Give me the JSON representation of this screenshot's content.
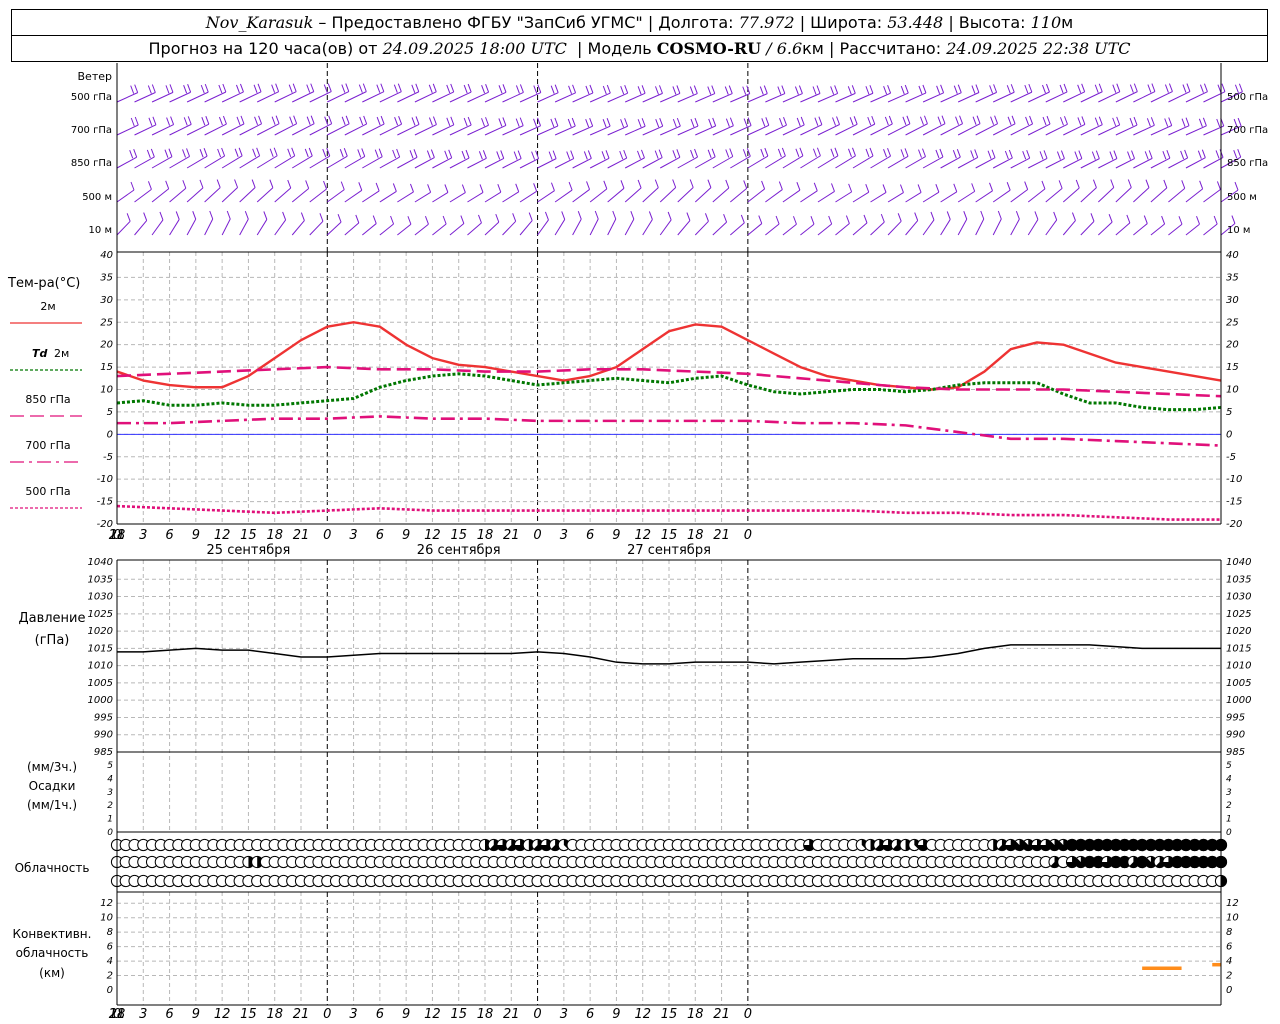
{
  "header": {
    "station": "Nov_Karasuk",
    "provider": "– Предоставлено ФГБУ \"ЗапСиб УГМС\" | Долгота:",
    "lon": "77.972",
    "lat_label": "| Широта:",
    "lat": "53.448",
    "alt_label": "| Высота:",
    "alt": "110",
    "alt_unit": "м",
    "fc_label": "Прогноз на 120 часа(ов) от",
    "fc_start": "24.09.2025 18:00 UTC",
    "model_label": "| Модель",
    "model": "COSMO-RU",
    "res": "/ 6.6",
    "res_unit": "км",
    "calc_label": "| Рассчитано:",
    "calc": "24.09.2025 22:38 UTC"
  },
  "x_ticks": [
    "18",
    "21",
    "0",
    "3",
    "6",
    "9",
    "12",
    "15",
    "18",
    "21",
    "0",
    "3",
    "6",
    "9",
    "12",
    "15",
    "18",
    "21",
    "0",
    "3",
    "6",
    "9",
    "12",
    "15",
    "18",
    "21",
    "0"
  ],
  "date_labels": [
    {
      "text": "25 сентября",
      "hour": 15
    },
    {
      "text": "26 сентября",
      "hour": 39
    },
    {
      "text": "27 сентября",
      "hour": 63
    }
  ],
  "wind_panel": {
    "title": "Ветер",
    "levels": [
      "500 гПа",
      "700 гПа",
      "850 гПа",
      "500 м",
      "10  м"
    ]
  },
  "temp_panel": {
    "title": "Тем-ра(°C)",
    "y_ticks": [
      "40",
      "35",
      "30",
      "25",
      "20",
      "15",
      "10",
      "5",
      "0",
      "-5",
      "-10",
      "-15",
      "-20"
    ],
    "legend": [
      {
        "label": "2м",
        "td": "",
        "color": "#ee3333",
        "dash": ""
      },
      {
        "label": "2м",
        "td": "Td",
        "color": "#007700",
        "dash": "3,2"
      },
      {
        "label": "850 гПа",
        "td": "",
        "color": "#e0107a",
        "dash": "14,6"
      },
      {
        "label": "700 гПа",
        "td": "",
        "color": "#e0107a",
        "dash": "14,5,3,5"
      },
      {
        "label": "500 гПа",
        "td": "",
        "color": "#e0107a",
        "dash": "3,2"
      }
    ]
  },
  "pressure_panel": {
    "title": "Давление",
    "unit": "(гПа)",
    "y_ticks": [
      "1040",
      "1035",
      "1030",
      "1025",
      "1020",
      "1015",
      "1010",
      "1005",
      "1000",
      "995",
      "990",
      "985"
    ]
  },
  "precip_panel": {
    "label_top": "(мм/3ч.)",
    "title": "Осадки",
    "label_bottom": "(мм/1ч.)",
    "y_ticks": [
      "5",
      "4",
      "3",
      "2",
      "1",
      "0"
    ]
  },
  "cloud_panel": {
    "title": "Облачность"
  },
  "conv_panel": {
    "title1": "Конвективн.",
    "title2": "облачность",
    "unit": "(км)",
    "y_ticks": [
      "12",
      "10",
      "8",
      "6",
      "4",
      "2",
      "0"
    ]
  },
  "colors": {
    "wind": "#7a1fd0",
    "t2m": "#ee3333",
    "td2m": "#007700",
    "upper": "#e0107a",
    "zero_line": "#3333ff",
    "pressure": "#000000",
    "conv_cloud": "#ff8c1a"
  },
  "chart_data": [
    {
      "type": "line",
      "title": "Тем-ра(°C)",
      "x_unit": "hours from 24.09.2025 18:00 UTC",
      "ylim": [
        -20,
        40
      ],
      "grid": true,
      "series": [
        {
          "name": "2м",
          "x": [
            0,
            3,
            6,
            9,
            12,
            15,
            18,
            21,
            24,
            27,
            30,
            33,
            36,
            39,
            42,
            45,
            48,
            51,
            54,
            57,
            60,
            63,
            66,
            69,
            72,
            75,
            78,
            81,
            84,
            87,
            90,
            93,
            96,
            99,
            102,
            105,
            108,
            111,
            114,
            117,
            120,
            123,
            126
          ],
          "values": [
            14,
            12,
            11,
            10.5,
            10.5,
            13,
            17,
            21,
            24,
            25,
            24,
            20,
            17,
            15.5,
            15,
            14,
            13,
            12,
            13,
            15,
            19,
            23,
            24.5,
            24,
            21,
            18,
            15,
            13,
            12,
            11,
            10.5,
            10,
            10.5,
            14,
            19,
            20.5,
            20,
            18,
            16,
            15,
            14,
            13,
            12
          ]
        },
        {
          "name": "Td 2м",
          "x": [
            0,
            3,
            6,
            9,
            12,
            15,
            18,
            21,
            24,
            27,
            30,
            33,
            36,
            39,
            42,
            45,
            48,
            51,
            54,
            57,
            60,
            63,
            66,
            69,
            72,
            75,
            78,
            81,
            84,
            87,
            90,
            93,
            96,
            99,
            102,
            105,
            108,
            111,
            114,
            117,
            120,
            123,
            126
          ],
          "values": [
            7,
            7.5,
            6.5,
            6.5,
            7,
            6.5,
            6.5,
            7,
            7.5,
            8,
            10.5,
            12,
            13,
            13.5,
            13,
            12,
            11,
            11.5,
            12,
            12.5,
            12,
            11.5,
            12.5,
            13,
            11,
            9.5,
            9,
            9.5,
            10,
            10,
            9.5,
            10,
            11,
            11.5,
            11.5,
            11.5,
            9,
            7,
            7,
            6,
            5.5,
            5.5,
            6
          ]
        },
        {
          "name": "850 гПа",
          "x": [
            0,
            6,
            12,
            18,
            24,
            30,
            36,
            42,
            48,
            54,
            60,
            66,
            72,
            78,
            84,
            90,
            96,
            102,
            108,
            114,
            120,
            126
          ],
          "values": [
            13,
            13.5,
            14,
            14.5,
            15,
            14.5,
            14.5,
            14,
            14,
            14.5,
            14.5,
            14,
            13.5,
            12.5,
            11.5,
            10.5,
            10,
            10,
            10,
            9.5,
            9,
            8.5
          ]
        },
        {
          "name": "700 гПа",
          "x": [
            0,
            6,
            12,
            18,
            24,
            30,
            36,
            42,
            48,
            54,
            60,
            66,
            72,
            78,
            84,
            90,
            96,
            102,
            108,
            114,
            120,
            126
          ],
          "values": [
            2.5,
            2.5,
            3,
            3.5,
            3.5,
            4,
            3.5,
            3.5,
            3,
            3,
            3,
            3,
            3,
            2.5,
            2.5,
            2,
            0.5,
            -1,
            -1,
            -1.5,
            -2,
            -2.5
          ]
        },
        {
          "name": "500 гПа",
          "x": [
            0,
            6,
            12,
            18,
            24,
            30,
            36,
            42,
            48,
            54,
            60,
            66,
            72,
            78,
            84,
            90,
            96,
            102,
            108,
            114,
            120,
            126
          ],
          "values": [
            -16,
            -16.5,
            -17,
            -17.5,
            -17,
            -16.5,
            -17,
            -17,
            -17,
            -17,
            -17,
            -17,
            -17,
            -17,
            -17,
            -17.5,
            -17.5,
            -18,
            -18,
            -18.5,
            -19,
            -19
          ]
        }
      ]
    },
    {
      "type": "line",
      "title": "Давление",
      "ylabel": "(гПа)",
      "x_unit": "hours from 24.09.2025 18:00 UTC",
      "ylim": [
        985,
        1040
      ],
      "grid": true,
      "series": [
        {
          "name": "",
          "x": [
            0,
            3,
            6,
            9,
            12,
            15,
            18,
            21,
            24,
            27,
            30,
            33,
            36,
            39,
            42,
            45,
            48,
            51,
            54,
            57,
            60,
            63,
            66,
            69,
            72,
            75,
            78,
            81,
            84,
            87,
            90,
            93,
            96,
            99,
            102,
            105,
            108,
            111,
            114,
            117,
            120,
            123,
            126
          ],
          "values": [
            1014,
            1014,
            1014.5,
            1015,
            1014.5,
            1014.5,
            1013.5,
            1012.5,
            1012.5,
            1013,
            1013.5,
            1013.5,
            1013.5,
            1013.5,
            1013.5,
            1013.5,
            1014,
            1013.5,
            1012.5,
            1011,
            1010.5,
            1010.5,
            1011,
            1011,
            1011,
            1010.5,
            1011,
            1011.5,
            1012,
            1012,
            1012,
            1012.5,
            1013.5,
            1015,
            1016,
            1016,
            1016,
            1016,
            1015.5,
            1015,
            1015,
            1015,
            1015
          ]
        }
      ]
    },
    {
      "type": "bar",
      "title": "Конвективн. облачность",
      "ylabel": "(км)",
      "ylim": [
        0,
        13
      ],
      "series": [
        {
          "name": "",
          "segments": [
            {
              "from_hour": 117,
              "to_hour": 121.5,
              "height_km": 3
            },
            {
              "from_hour": 125,
              "to_hour": 126,
              "height_km": 3.5
            }
          ]
        }
      ]
    },
    {
      "type": "table",
      "title": "Облачность",
      "note": "cloud cover in eighths (0-8), three layers per 1-hour step",
      "layers": [
        {
          "name": "upper",
          "hour_values": [
            [
              0,
              0
            ],
            [
              41,
              0
            ],
            [
              42,
              4
            ],
            [
              43,
              5
            ],
            [
              44,
              6
            ],
            [
              45,
              5
            ],
            [
              46,
              6
            ],
            [
              47,
              4
            ],
            [
              48,
              5
            ],
            [
              49,
              6
            ],
            [
              50,
              5
            ],
            [
              51,
              3
            ],
            [
              52,
              0
            ],
            [
              78,
              0
            ],
            [
              79,
              6
            ],
            [
              80,
              0
            ],
            [
              84,
              0
            ],
            [
              85,
              3
            ],
            [
              86,
              4
            ],
            [
              87,
              5
            ],
            [
              88,
              6
            ],
            [
              89,
              5
            ],
            [
              90,
              4
            ],
            [
              91,
              3
            ],
            [
              92,
              6
            ],
            [
              93,
              0
            ],
            [
              99,
              0
            ],
            [
              100,
              4
            ],
            [
              101,
              5
            ],
            [
              102,
              6
            ],
            [
              103,
              7
            ],
            [
              104,
              7
            ],
            [
              105,
              6
            ],
            [
              106,
              6
            ],
            [
              107,
              7
            ],
            [
              108,
              7
            ],
            [
              109,
              8
            ],
            [
              126,
              8
            ]
          ]
        },
        {
          "name": "middle",
          "hour_values": [
            [
              0,
              0
            ],
            [
              14,
              0
            ],
            [
              15,
              4
            ],
            [
              16,
              4
            ],
            [
              17,
              0
            ],
            [
              106,
              0
            ],
            [
              107,
              5
            ],
            [
              108,
              0
            ],
            [
              109,
              6
            ],
            [
              110,
              7
            ],
            [
              111,
              8
            ],
            [
              112,
              8
            ],
            [
              113,
              6
            ],
            [
              114,
              8
            ],
            [
              115,
              8
            ],
            [
              116,
              5
            ],
            [
              117,
              8
            ],
            [
              118,
              7
            ],
            [
              119,
              5
            ],
            [
              120,
              6
            ],
            [
              121,
              8
            ],
            [
              122,
              8
            ],
            [
              126,
              8
            ]
          ]
        },
        {
          "name": "low",
          "hour_values": [
            [
              0,
              0
            ],
            [
              125,
              0
            ],
            [
              126,
              4
            ]
          ]
        }
      ]
    }
  ]
}
